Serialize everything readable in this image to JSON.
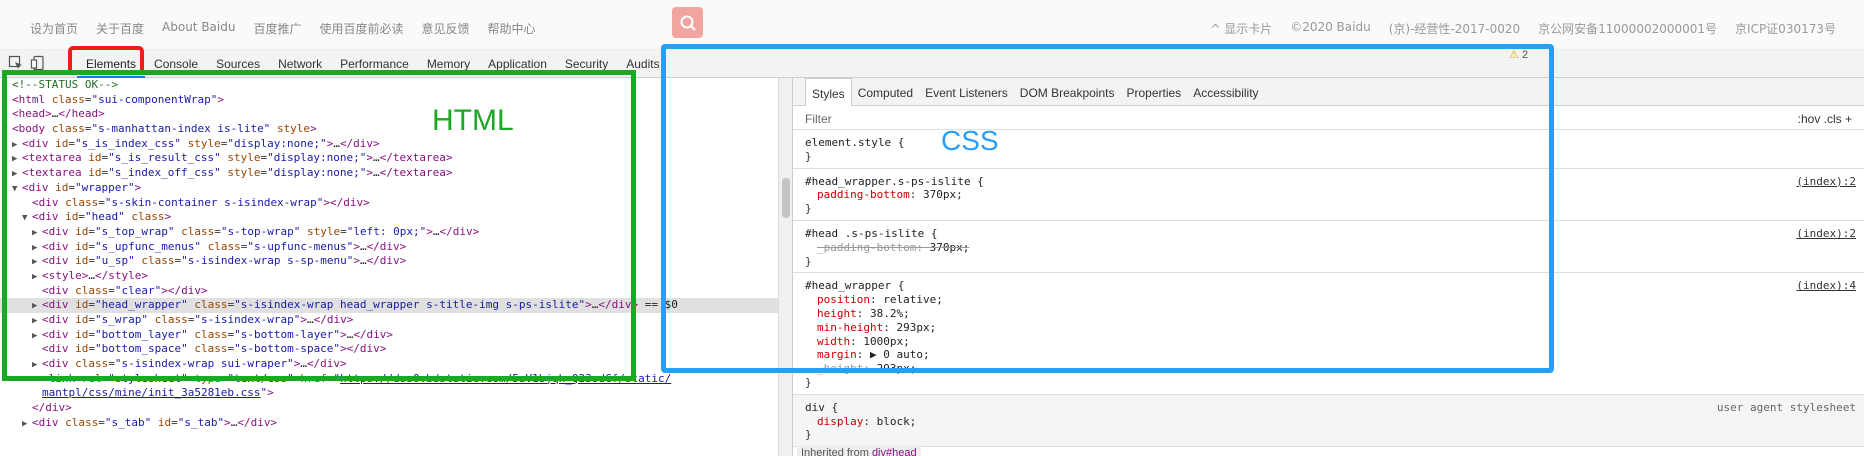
{
  "topbar": {
    "links": [
      "设为首页",
      "关于百度",
      "About Baidu",
      "百度推广",
      "使用百度前必读",
      "意见反馈",
      "帮助中心"
    ],
    "right": [
      "^ 显示卡片",
      "©2020 Baidu",
      "(京)-经营性-2017-0020",
      "京公网安备11000002000001号",
      "京ICP证030173号"
    ]
  },
  "devtools": {
    "tabs": [
      "Elements",
      "Console",
      "Sources",
      "Network",
      "Performance",
      "Memory",
      "Application",
      "Security",
      "Audits"
    ],
    "warning_count": "2"
  },
  "elements_lines": [
    {
      "indent": 0,
      "html": "<span class='cm'>&lt;!--STATUS OK--&gt;</span>"
    },
    {
      "indent": 0,
      "html": "<span class='tg'>&lt;html</span> <span class='an'>class</span>=<span class='av'>\"sui-componentWrap\"</span><span class='tg'>&gt;</span>"
    },
    {
      "indent": 0,
      "arrow": "▶",
      "html": "<span class='tg'>&lt;head&gt;</span><span class='tx'>…</span><span class='tg'>&lt;/head&gt;</span>"
    },
    {
      "indent": 0,
      "arrow": "▼",
      "html": "<span class='tg'>&lt;body</span> <span class='an'>class</span>=<span class='av'>\"s-manhattan-index is-lite\"</span> <span class='an'>style</span><span class='tg'>&gt;</span>"
    },
    {
      "indent": 1,
      "arrow": "▶",
      "html": "<span class='tg'>&lt;div</span> <span class='an'>id</span>=<span class='av'>\"s_is_index_css\"</span> <span class='an'>style</span>=<span class='av'>\"display:none;\"</span><span class='tg'>&gt;</span><span class='tx'>…</span><span class='tg'>&lt;/div&gt;</span>"
    },
    {
      "indent": 1,
      "arrow": "▶",
      "html": "<span class='tg'>&lt;textarea</span> <span class='an'>id</span>=<span class='av'>\"s_is_result_css\"</span> <span class='an'>style</span>=<span class='av'>\"display:none;\"</span><span class='tg'>&gt;</span><span class='tx'>…</span><span class='tg'>&lt;/textarea&gt;</span>"
    },
    {
      "indent": 1,
      "arrow": "▶",
      "html": "<span class='tg'>&lt;textarea</span> <span class='an'>id</span>=<span class='av'>\"s_index_off_css\"</span> <span class='an'>style</span>=<span class='av'>\"display:none;\"</span><span class='tg'>&gt;</span><span class='tx'>…</span><span class='tg'>&lt;/textarea&gt;</span>"
    },
    {
      "indent": 1,
      "arrow": "▼",
      "html": "<span class='tg'>&lt;div</span> <span class='an'>id</span>=<span class='av'>\"wrapper\"</span><span class='tg'>&gt;</span>"
    },
    {
      "indent": 2,
      "html": "<span class='tg'>&lt;div</span> <span class='an'>class</span>=<span class='av'>\"s-skin-container s-isindex-wrap\"</span><span class='tg'>&gt;&lt;/div&gt;</span>"
    },
    {
      "indent": 2,
      "arrow": "▼",
      "html": "<span class='tg'>&lt;div</span> <span class='an'>id</span>=<span class='av'>\"head\"</span> <span class='an'>class</span><span class='tg'>&gt;</span>"
    },
    {
      "indent": 3,
      "arrow": "▶",
      "html": "<span class='tg'>&lt;div</span> <span class='an'>id</span>=<span class='av'>\"s_top_wrap\"</span> <span class='an'>class</span>=<span class='av'>\"s-top-wrap\"</span> <span class='an'>style</span>=<span class='av'>\"left: 0px;\"</span><span class='tg'>&gt;</span><span class='tx'>…</span><span class='tg'>&lt;/div&gt;</span>"
    },
    {
      "indent": 3,
      "arrow": "▶",
      "html": "<span class='tg'>&lt;div</span> <span class='an'>id</span>=<span class='av'>\"s_upfunc_menus\"</span> <span class='an'>class</span>=<span class='av'>\"s-upfunc-menus\"</span><span class='tg'>&gt;</span><span class='tx'>…</span><span class='tg'>&lt;/div&gt;</span>"
    },
    {
      "indent": 3,
      "arrow": "▶",
      "html": "<span class='tg'>&lt;div</span> <span class='an'>id</span>=<span class='av'>\"u_sp\"</span> <span class='an'>class</span>=<span class='av'>\"s-isindex-wrap s-sp-menu\"</span><span class='tg'>&gt;</span><span class='tx'>…</span><span class='tg'>&lt;/div&gt;</span>"
    },
    {
      "indent": 3,
      "arrow": "▶",
      "html": "<span class='tg'>&lt;style&gt;</span><span class='tx'>…</span><span class='tg'>&lt;/style&gt;</span>"
    },
    {
      "indent": 3,
      "html": "<span class='tg'>&lt;div</span> <span class='an'>class</span>=<span class='av'>\"clear\"</span><span class='tg'>&gt;&lt;/div&gt;</span>"
    },
    {
      "indent": 3,
      "arrow": "▶",
      "sel": true,
      "html": "<span class='tg'>&lt;div</span> <span class='an'>id</span>=<span class='av'>\"head_wrapper\"</span> <span class='an'>class</span>=<span class='av'>\"s-isindex-wrap head_wrapper s-title-img  s-ps-islite\"</span><span class='tg'>&gt;</span><span class='tx'>…</span><span class='tg'>&lt;/div&gt;</span><span class='tx'> == $0</span>"
    },
    {
      "indent": 3,
      "arrow": "▶",
      "html": "<span class='tg'>&lt;div</span> <span class='an'>id</span>=<span class='av'>\"s_wrap\"</span> <span class='an'>class</span>=<span class='av'>\"s-isindex-wrap\"</span><span class='tg'>&gt;</span><span class='tx'>…</span><span class='tg'>&lt;/div&gt;</span>"
    },
    {
      "indent": 3,
      "arrow": "▶",
      "html": "<span class='tg'>&lt;div</span> <span class='an'>id</span>=<span class='av'>\"bottom_layer\"</span> <span class='an'>class</span>=<span class='av'>\"s-bottom-layer\"</span><span class='tg'>&gt;</span><span class='tx'>…</span><span class='tg'>&lt;/div&gt;</span>"
    },
    {
      "indent": 3,
      "html": "<span class='tg'>&lt;div</span> <span class='an'>id</span>=<span class='av'>\"bottom_space\"</span> <span class='an'>class</span>=<span class='av'>\"s-bottom-space\"</span><span class='tg'>&gt;&lt;/div&gt;</span>"
    },
    {
      "indent": 3,
      "arrow": "▶",
      "html": "<span class='tg'>&lt;div</span> <span class='an'>class</span>=<span class='av'>\"s-isindex-wrap sui-wraper\"</span><span class='tg'>&gt;</span><span class='tx'>…</span><span class='tg'>&lt;/div&gt;</span>"
    },
    {
      "indent": 3,
      "html": "<span class='tg'>&lt;link</span> <span class='an'>rel</span>=<span class='av'>\"stylesheet\"</span> <span class='an'>type</span>=<span class='av'>\"text/css\"</span> <span class='an'>href</span>=<span class='av'>\"</span><span class='lk'>https://dss0.bdstatic.com/5aV1bjqh_Q23odCf/static/</span>"
    },
    {
      "indent": 3,
      "html": "<span class='lk'>mantpl/css/mine/init_3a5281eb.css</span><span class='av'>\"</span><span class='tg'>&gt;</span>"
    },
    {
      "indent": 2,
      "html": "<span class='tg'>&lt;/div&gt;</span>"
    },
    {
      "indent": 2,
      "arrow": "▶",
      "html": "<span class='tg'>&lt;div</span> <span class='an'>class</span>=<span class='av'>\"s_tab\"</span> <span class='an'>id</span>=<span class='av'>\"s_tab\"</span><span class='tg'>&gt;</span><span class='tx'>…</span><span class='tg'>&lt;/div&gt;</span>"
    }
  ],
  "styles": {
    "subtabs": [
      "Styles",
      "Computed",
      "Event Listeners",
      "DOM Breakpoints",
      "Properties",
      "Accessibility"
    ],
    "filter_placeholder": "Filter",
    "hov_cls": ":hov  .cls  +",
    "rules": [
      {
        "selector": "element.style {",
        "source": "",
        "decls": []
      },
      {
        "selector": "#head_wrapper.s-ps-islite {",
        "source": "(index):2",
        "decls": [
          {
            "p": "padding-bottom",
            "v": "370px;"
          }
        ]
      },
      {
        "selector": "#head .s-ps-islite {",
        "source": "(index):2",
        "decls": [
          {
            "p": "_padding-bottom",
            "v": "370px;",
            "strike": true
          }
        ]
      },
      {
        "selector": "#head_wrapper {",
        "source": "(index):4",
        "decls": [
          {
            "p": "position",
            "v": "relative;"
          },
          {
            "p": "height",
            "v": "38.2%;"
          },
          {
            "p": "min-height",
            "v": "293px;"
          },
          {
            "p": "width",
            "v": "1000px;"
          },
          {
            "p": "margin",
            "v": "▶ 0 auto;"
          },
          {
            "p": "_height",
            "v": "293px;",
            "strike": true
          }
        ]
      },
      {
        "selector": "div {",
        "source": "user agent stylesheet",
        "ua": true,
        "decls": [
          {
            "p": "display",
            "v": "block;"
          }
        ]
      }
    ],
    "inherited_label": "Inherited from",
    "inherited_el": "div#head"
  },
  "annotations": {
    "html_label": "HTML",
    "css_label": "CSS"
  },
  "colors": {
    "green_box": "#1aa923",
    "blue_box": "#27a0f2",
    "red_box": "#e8201b"
  }
}
